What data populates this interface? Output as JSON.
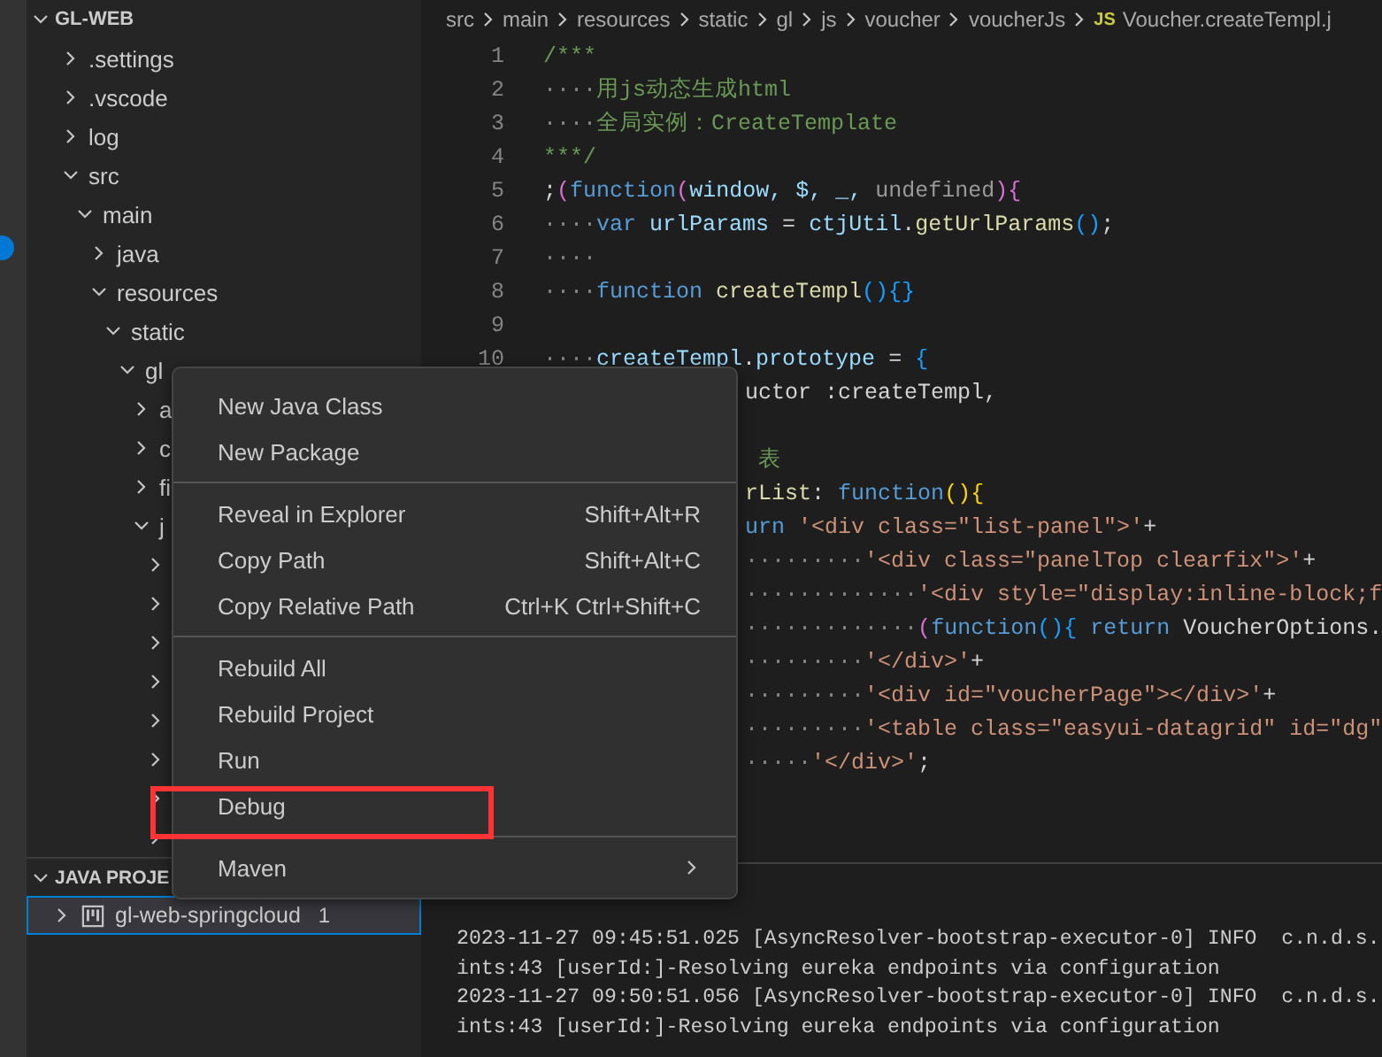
{
  "explorer": {
    "title": "GL-WEB",
    "expanded": true,
    "items": [
      {
        "label": ".settings",
        "expanded": false
      },
      {
        "label": ".vscode",
        "expanded": false
      },
      {
        "label": "log",
        "expanded": false
      },
      {
        "label": "src",
        "expanded": true,
        "children": [
          {
            "label": "main",
            "expanded": true,
            "children": [
              {
                "label": "java",
                "expanded": false
              },
              {
                "label": "resources",
                "expanded": true,
                "children": [
                  {
                    "label": "static",
                    "expanded": true,
                    "children": [
                      {
                        "label": "gl",
                        "expanded": true,
                        "children": [
                          {
                            "label": "a",
                            "expanded": false
                          },
                          {
                            "label": "c",
                            "expanded": false
                          },
                          {
                            "label": "fi",
                            "expanded": false
                          },
                          {
                            "label": "j",
                            "expanded": true,
                            "children": [
                              {
                                "expanded": false
                              },
                              {
                                "expanded": false
                              },
                              {
                                "expanded": false
                              },
                              {
                                "expanded": false
                              },
                              {
                                "expanded": false
                              },
                              {
                                "expanded": false
                              },
                              {
                                "expanded": false
                              },
                              {
                                "expanded": false
                              }
                            ]
                          }
                        ]
                      }
                    ]
                  }
                ]
              }
            ]
          }
        ]
      }
    ]
  },
  "java_projects": {
    "title": "JAVA PROJE",
    "expanded": true,
    "items": [
      {
        "label": "gl-web-springcloud",
        "badge": "1",
        "expanded": false,
        "selected": true
      }
    ]
  },
  "breadcrumb": [
    {
      "label": "src",
      "kind": "folder"
    },
    {
      "label": "main",
      "kind": "folder"
    },
    {
      "label": "resources",
      "kind": "folder"
    },
    {
      "label": "static",
      "kind": "folder"
    },
    {
      "label": "gl",
      "kind": "folder"
    },
    {
      "label": "js",
      "kind": "folder"
    },
    {
      "label": "voucher",
      "kind": "folder"
    },
    {
      "label": "voucherJs",
      "kind": "folder"
    },
    {
      "label": "Voucher.createTempl.j",
      "kind": "file",
      "file_type": "JS"
    }
  ],
  "editor": {
    "lines": [
      {
        "kind": "visible",
        "number": "1",
        "tokens": [
          {
            "text": "/***",
            "kind": "comment"
          }
        ]
      },
      {
        "kind": "visible",
        "number": "2",
        "tokens": [
          {
            "text": "····",
            "kind": "space"
          },
          {
            "text": "用js动态生成html",
            "kind": "comment"
          }
        ]
      },
      {
        "kind": "visible",
        "number": "3",
        "tokens": [
          {
            "text": "····",
            "kind": "space"
          },
          {
            "text": "全局实例：CreateTemplate",
            "kind": "comment"
          }
        ]
      },
      {
        "kind": "visible",
        "number": "4",
        "tokens": [
          {
            "text": "***/",
            "kind": "comment"
          }
        ]
      },
      {
        "kind": "visible",
        "number": "5",
        "tokens": [
          {
            "text": ";",
            "kind": "plain"
          },
          {
            "text": "(",
            "kind": "bracket2"
          },
          {
            "text": "function",
            "kind": "keyword"
          },
          {
            "text": "(",
            "kind": "bracket2"
          },
          {
            "text": "window, $, _, ",
            "kind": "variable"
          },
          {
            "text": "undefined",
            "kind": "dim"
          },
          {
            "text": "){",
            "kind": "bracket2"
          }
        ]
      },
      {
        "kind": "visible",
        "number": "6",
        "tokens": [
          {
            "text": "····",
            "kind": "space"
          },
          {
            "text": "var",
            "kind": "keyword"
          },
          {
            "text": " urlParams",
            "kind": "variable"
          },
          {
            "text": " = ",
            "kind": "plain"
          },
          {
            "text": "ctjUtil",
            "kind": "variable"
          },
          {
            "text": ".",
            "kind": "plain"
          },
          {
            "text": "getUrlParams",
            "kind": "function"
          },
          {
            "text": "()",
            "kind": "bracket3"
          },
          {
            "text": ";",
            "kind": "plain"
          }
        ]
      },
      {
        "kind": "visible",
        "number": "7",
        "tokens": [
          {
            "text": "····",
            "kind": "space"
          }
        ]
      },
      {
        "kind": "visible",
        "number": "8",
        "tokens": [
          {
            "text": "····",
            "kind": "space"
          },
          {
            "text": "function",
            "kind": "keyword"
          },
          {
            "text": " createTempl",
            "kind": "function"
          },
          {
            "text": "(){}",
            "kind": "bracket3"
          }
        ]
      },
      {
        "kind": "visible",
        "number": "9"
      },
      {
        "kind": "visible",
        "number": "10",
        "tokens": [
          {
            "text": "····",
            "kind": "space"
          },
          {
            "text": "createTempl",
            "kind": "variable"
          },
          {
            "text": ".",
            "kind": "plain"
          },
          {
            "text": "prototype",
            "kind": "variable"
          },
          {
            "text": " = ",
            "kind": "plain"
          },
          {
            "text": "{",
            "kind": "bracket3"
          }
        ]
      },
      {
        "kind": "covered",
        "tokens": [
          {
            "text": "uctor :createTempl,",
            "kind": "plain"
          }
        ]
      },
      {
        "kind": "covered"
      },
      {
        "kind": "covered",
        "tokens": [
          {
            "text": " 表",
            "kind": "comment"
          }
        ]
      },
      {
        "kind": "covered",
        "tokens": [
          {
            "text": "rList",
            "kind": "function"
          },
          {
            "text": ": ",
            "kind": "plain"
          },
          {
            "text": "function",
            "kind": "keyword"
          },
          {
            "text": "(){",
            "kind": "bracket1"
          }
        ]
      },
      {
        "kind": "covered",
        "tokens": [
          {
            "text": "urn",
            "kind": "keyword"
          },
          {
            "text": " '<div class=\"list-panel\">'",
            "kind": "string"
          },
          {
            "text": "+",
            "kind": "plain"
          }
        ]
      },
      {
        "kind": "covered",
        "tokens": [
          {
            "text": "·········",
            "kind": "space"
          },
          {
            "text": "'<div class=\"panelTop clearfix\">'",
            "kind": "string"
          },
          {
            "text": "+",
            "kind": "plain"
          }
        ]
      },
      {
        "kind": "covered",
        "tokens": [
          {
            "text": "·············",
            "kind": "space"
          },
          {
            "text": "'<div style=\"display:inline-block;f",
            "kind": "string"
          }
        ]
      },
      {
        "kind": "covered",
        "tokens": [
          {
            "text": "·············",
            "kind": "space"
          },
          {
            "text": "(",
            "kind": "bracket2"
          },
          {
            "text": "function",
            "kind": "keyword"
          },
          {
            "text": "(){",
            "kind": "bracket3"
          },
          {
            "text": " return",
            "kind": "keyword"
          },
          {
            "text": " VoucherOptions.",
            "kind": "plain"
          }
        ]
      },
      {
        "kind": "covered",
        "tokens": [
          {
            "text": "·········",
            "kind": "space"
          },
          {
            "text": "'</div>'",
            "kind": "string"
          },
          {
            "text": "+",
            "kind": "plain"
          }
        ]
      },
      {
        "kind": "covered",
        "tokens": [
          {
            "text": "·········",
            "kind": "space"
          },
          {
            "text": "'<div id=\"voucherPage\"></div>'",
            "kind": "string"
          },
          {
            "text": "+",
            "kind": "plain"
          }
        ]
      },
      {
        "kind": "covered",
        "tokens": [
          {
            "text": "·········",
            "kind": "space"
          },
          {
            "text": "'<table class=\"easyui-datagrid\" id=\"dg\"",
            "kind": "string"
          }
        ]
      },
      {
        "kind": "covered",
        "tokens": [
          {
            "text": "·····",
            "kind": "space"
          },
          {
            "text": "'</div>'",
            "kind": "string"
          },
          {
            "text": ";",
            "kind": "plain"
          }
        ]
      }
    ]
  },
  "terminal": {
    "lines": [
      "2023-11-27 09:45:51.025 [AsyncResolver-bootstrap-executor-0] INFO  c.n.d.s.",
      "ints:43 [userId:]-Resolving eureka endpoints via configuration",
      "2023-11-27 09:50:51.056 [AsyncResolver-bootstrap-executor-0] INFO  c.n.d.s.",
      "ints:43 [userId:]-Resolving eureka endpoints via configuration"
    ]
  },
  "context_menu": {
    "groups": [
      [
        {
          "label": "New Java Class"
        },
        {
          "label": "New Package"
        }
      ],
      [
        {
          "label": "Reveal in Explorer",
          "shortcut": "Shift+Alt+R"
        },
        {
          "label": "Copy Path",
          "shortcut": "Shift+Alt+C"
        },
        {
          "label": "Copy Relative Path",
          "shortcut": "Ctrl+K Ctrl+Shift+C"
        }
      ],
      [
        {
          "label": "Rebuild All"
        },
        {
          "label": "Rebuild Project"
        },
        {
          "label": "Run"
        },
        {
          "label": "Debug"
        }
      ],
      [
        {
          "label": "Maven",
          "submenu": true
        }
      ]
    ]
  }
}
